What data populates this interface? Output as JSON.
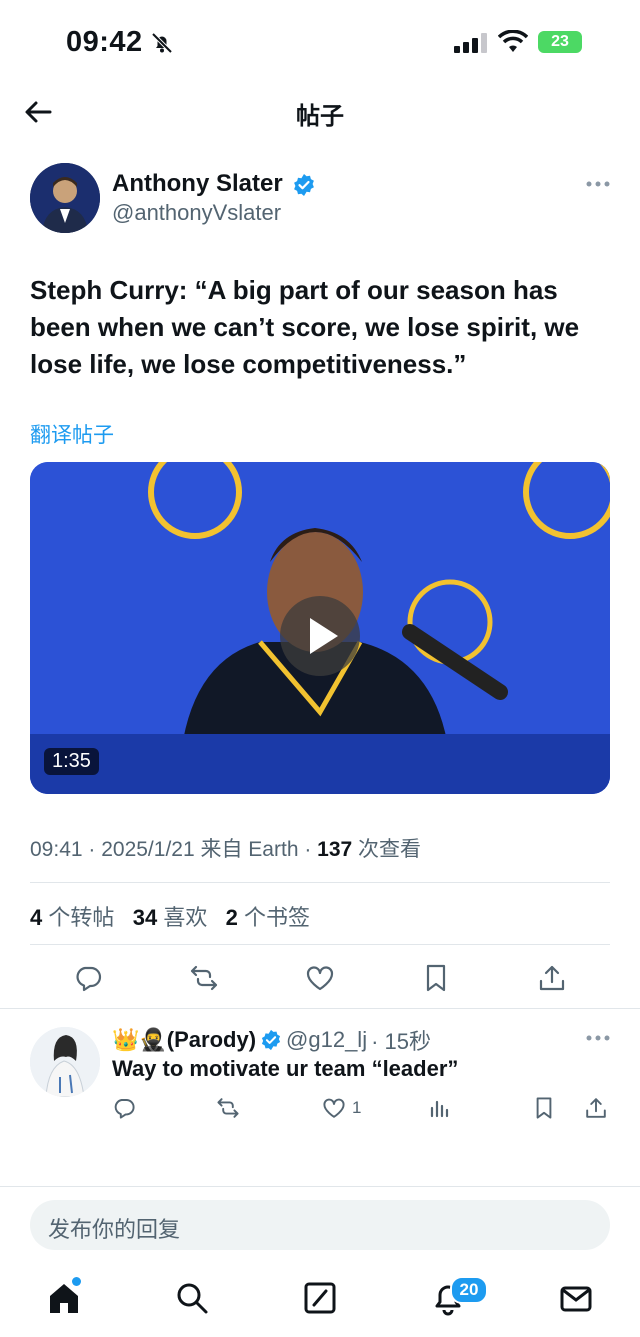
{
  "status_bar": {
    "time": "09:42",
    "battery": "23"
  },
  "header": {
    "title": "帖子"
  },
  "tweet": {
    "author_name": "Anthony Slater",
    "author_handle": "@anthonyVslater",
    "text": "Steph Curry: “A big part of our season has been when we can’t score, we lose spirit, we lose life, we lose competitiveness.”",
    "translate_label": "翻译帖子",
    "video_duration": "1:35",
    "meta_time": "09:41 · 2025/1/21 来自 Earth · ",
    "meta_views_count": "137",
    "meta_views_label": " 次查看",
    "stats": {
      "retweets_count": "4",
      "retweets_label": " 个转帖",
      "likes_count": "34",
      "likes_label": " 喜欢",
      "bookmarks_count": "2",
      "bookmarks_label": " 个书签"
    }
  },
  "reply": {
    "name": "👑🥷(Parody)",
    "handle": "@g12_lj",
    "time": "· 15秒",
    "text": "Way to motivate ur team “leader”",
    "like_count": "1"
  },
  "composer": {
    "placeholder": "发布你的回复"
  },
  "nav": {
    "notifications_badge": "20"
  },
  "colors": {
    "accent": "#1d9bf0",
    "text": "#0f1419",
    "secondary": "#536471"
  }
}
